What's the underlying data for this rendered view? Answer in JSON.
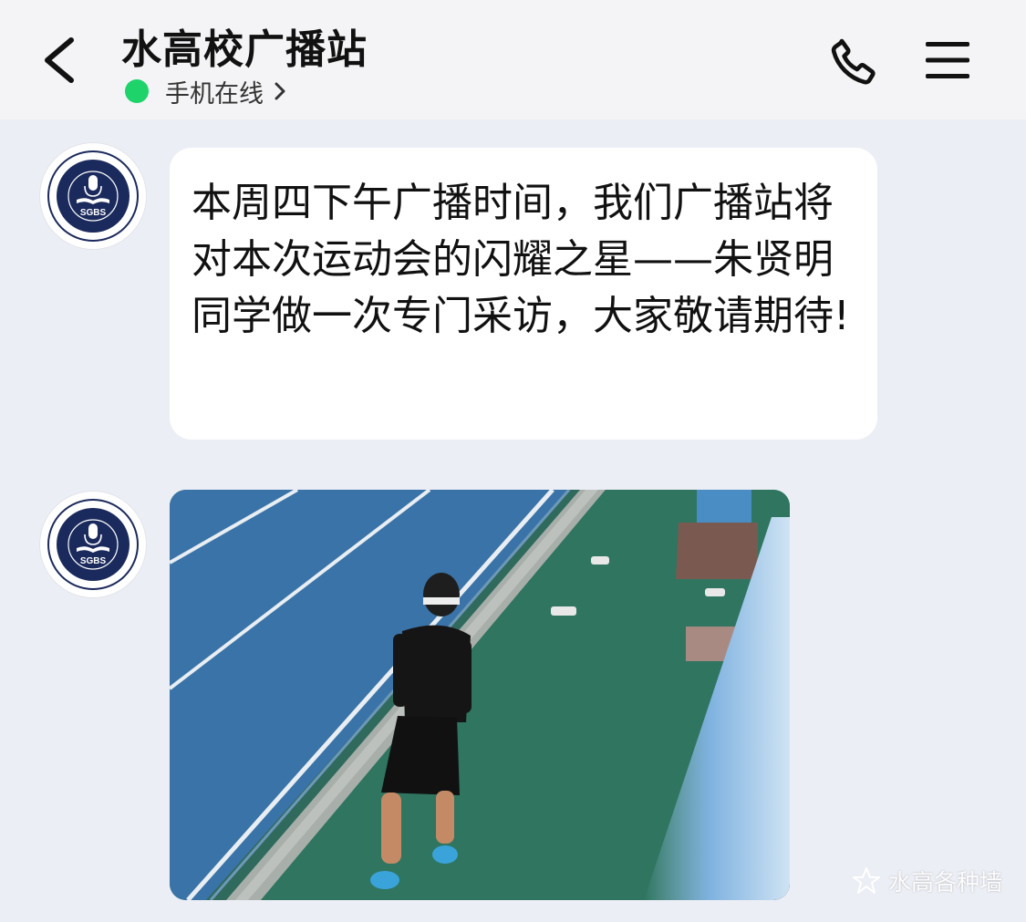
{
  "header": {
    "title": "水高校广播站",
    "status_text": "手机在线",
    "status_color": "#1ed36a"
  },
  "messages": [
    {
      "type": "text",
      "avatar_logo_text": "SGBS",
      "text": "本周四下午广播时间，我们广播站将对本次运动会的闪耀之星——朱贤明同学做一次专门采访，大家敬请期待!"
    },
    {
      "type": "image",
      "avatar_logo_text": "SGBS"
    }
  ],
  "watermark": {
    "text": "水高各种墙"
  },
  "colors": {
    "background": "#eceef5",
    "header_bg": "#f4f4f6",
    "bubble_bg": "#ffffff",
    "logo_navy": "#1b2a5c"
  }
}
